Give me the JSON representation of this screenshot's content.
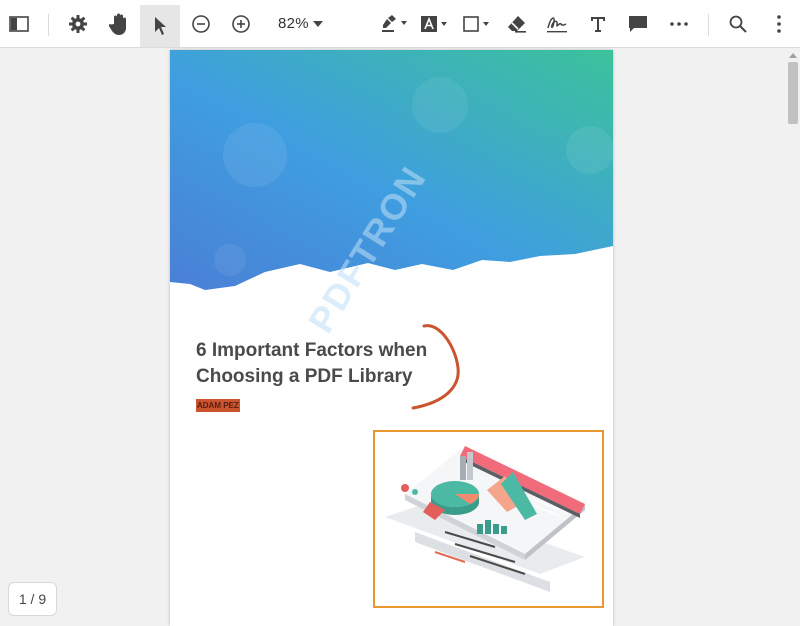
{
  "toolbar": {
    "zoom": "82%",
    "tools": [
      "sidebar-toggle",
      "settings",
      "pan",
      "select",
      "zoom-out",
      "zoom-in",
      "zoom-dropdown",
      "highlight",
      "text-box",
      "shape",
      "eraser",
      "signature",
      "free-text",
      "comment",
      "more",
      "search",
      "menu"
    ]
  },
  "document": {
    "title": "6 Important Factors when\nChoosing a PDF Library",
    "author": "ADAM PEZ",
    "watermark": "PDFTRON",
    "current_page": "1",
    "total_pages": "9",
    "page_indicator": "1 / 9"
  },
  "colors": {
    "gradient_start": "#4a90dc",
    "gradient_end": "#3bbf9c",
    "ink": "#c9542e",
    "selection": "#e8962e",
    "author_highlight": "#c9542e"
  }
}
